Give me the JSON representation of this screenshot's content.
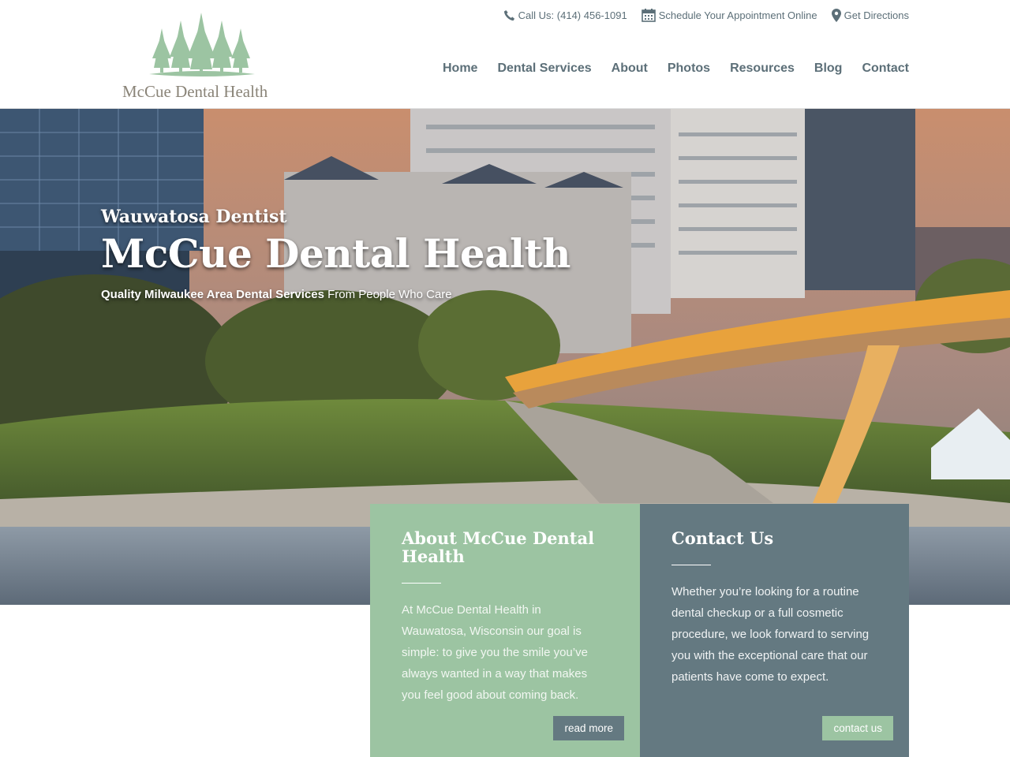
{
  "brand": {
    "name": "McCue Dental Health",
    "accent_green": "#9cc4a2",
    "accent_slate": "#647981"
  },
  "topbar": [
    {
      "icon": "phone-icon",
      "label": "Call Us: (414) 456-1091"
    },
    {
      "icon": "calendar-icon",
      "label": "Schedule Your Appointment Online"
    },
    {
      "icon": "map-pin-icon",
      "label": "Get Directions"
    }
  ],
  "nav": [
    "Home",
    "Dental Services",
    "About",
    "Photos",
    "Resources",
    "Blog",
    "Contact"
  ],
  "hero": {
    "subtitle": "Wauwatosa Dentist",
    "title": "McCue Dental Health",
    "tagline_bold": "Quality Milwaukee Area Dental Services",
    "tagline_rest": " From People Who Care"
  },
  "about": {
    "heading": "About McCue Dental Health",
    "body": "At McCue Dental Health in Wauwatosa, Wisconsin our goal is simple: to give you the smile you’ve always wanted in a way that makes you feel good about coming back.",
    "button": "read more"
  },
  "contact": {
    "heading": "Contact Us",
    "body": "Whether you’re looking for a routine dental checkup or a full cosmetic procedure, we look forward to serving you with the exceptional care that our patients have come to expect.",
    "button": "contact us"
  }
}
